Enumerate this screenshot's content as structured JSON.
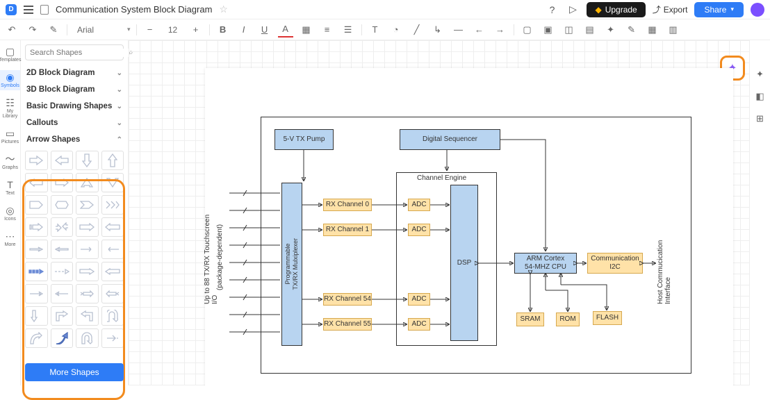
{
  "header": {
    "title": "Communication System Block Diagram",
    "upgrade": "Upgrade",
    "export": "Export",
    "share": "Share"
  },
  "toolbar": {
    "font": "Arial",
    "size": "12"
  },
  "rail": {
    "templates": "Templates",
    "symbols": "Symbols",
    "mylib": "My\nLibrary",
    "pictures": "Pictures",
    "graphs": "Graphs",
    "text": "Text",
    "icons": "Icons",
    "more": "More"
  },
  "sidebar": {
    "search_ph": "Search Shapes",
    "cat1": "2D Block Diagram",
    "cat2": "3D Block Diagram",
    "cat3": "Basic Drawing Shapes",
    "cat4": "Callouts",
    "cat5": "Arrow Shapes",
    "more": "More Shapes"
  },
  "diagram": {
    "tx_pump": "5-V TX Pump",
    "dig_seq": "Digital Sequencer",
    "chan_eng": "Channel Engine",
    "mux_l1": "Programmable",
    "mux_l2": "TX/RX Mulxiplexer",
    "io_l1": "Up to 88 TX/RX Touchscreen",
    "io_l2": "I/O",
    "io_l3": "(package-dependent)",
    "rx0": "RX Channel 0",
    "rx1": "RX Channel 1",
    "rx54": "RX Channel 54",
    "rx55": "RX Channel 55",
    "adc": "ADC",
    "dsp": "DSP",
    "cpu_l1": "ARM Cortex",
    "cpu_l2": "54-MHZ CPU",
    "comm_l1": "Communication",
    "comm_l2": "I2C",
    "sram": "SRAM",
    "rom": "ROM",
    "flash": "FLASH",
    "host_l1": "Host Commucication",
    "host_l2": "Interface"
  }
}
